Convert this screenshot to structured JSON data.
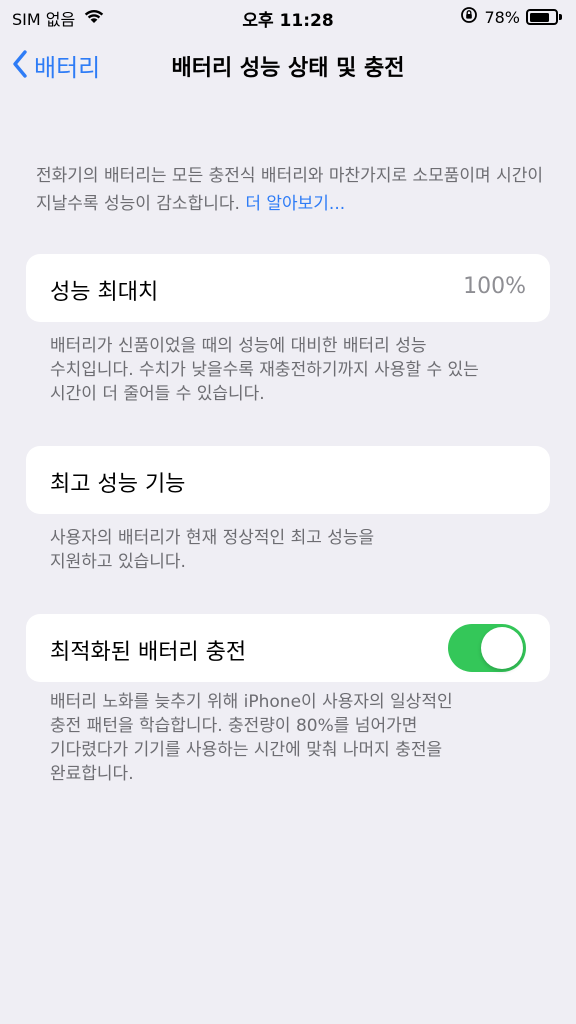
{
  "status_bar": {
    "carrier": "SIM 없음",
    "time": "오후 11:28",
    "battery_percent": "78%",
    "battery_level": 0.78
  },
  "nav": {
    "back_label": "배터리",
    "title": "배터리 성능 상태 및 충전"
  },
  "intro": {
    "text": "전화기의 배터리는 모든 충전식 배터리와 마찬가지로 소모품이며 시간이 지날수록 성능이 감소합니다.",
    "link": "더 알아보기..."
  },
  "max_capacity": {
    "label": "성능 최대치",
    "value": "100%",
    "footnote": [
      "배터리가 신품이었을 때의 성능에 대비한 배터리 성능",
      "수치입니다. 수치가 낮을수록 재충전하기까지 사용할 수 있는",
      "시간이 더 줄어들 수 있습니다."
    ]
  },
  "peak_performance": {
    "label": "최고 성능 기능",
    "footnote": [
      "사용자의 배터리가 현재 정상적인 최고 성능을",
      "지원하고 있습니다."
    ]
  },
  "optimized_charging": {
    "label": "최적화된 배터리 충전",
    "enabled": true,
    "footnote": [
      "배터리 노화를 늦추기 위해 iPhone이 사용자의 일상적인",
      "충전 패턴을 학습합니다. 충전량이 80%를 넘어가면",
      "기다렸다가 기기를 사용하는 시간에 맞춰 나머지 충전을",
      "완료합니다."
    ]
  },
  "colors": {
    "accent": "#2e7cf6",
    "toggle_on": "#34c759",
    "background": "#efeef4",
    "secondary_text": "#6d6d72"
  }
}
